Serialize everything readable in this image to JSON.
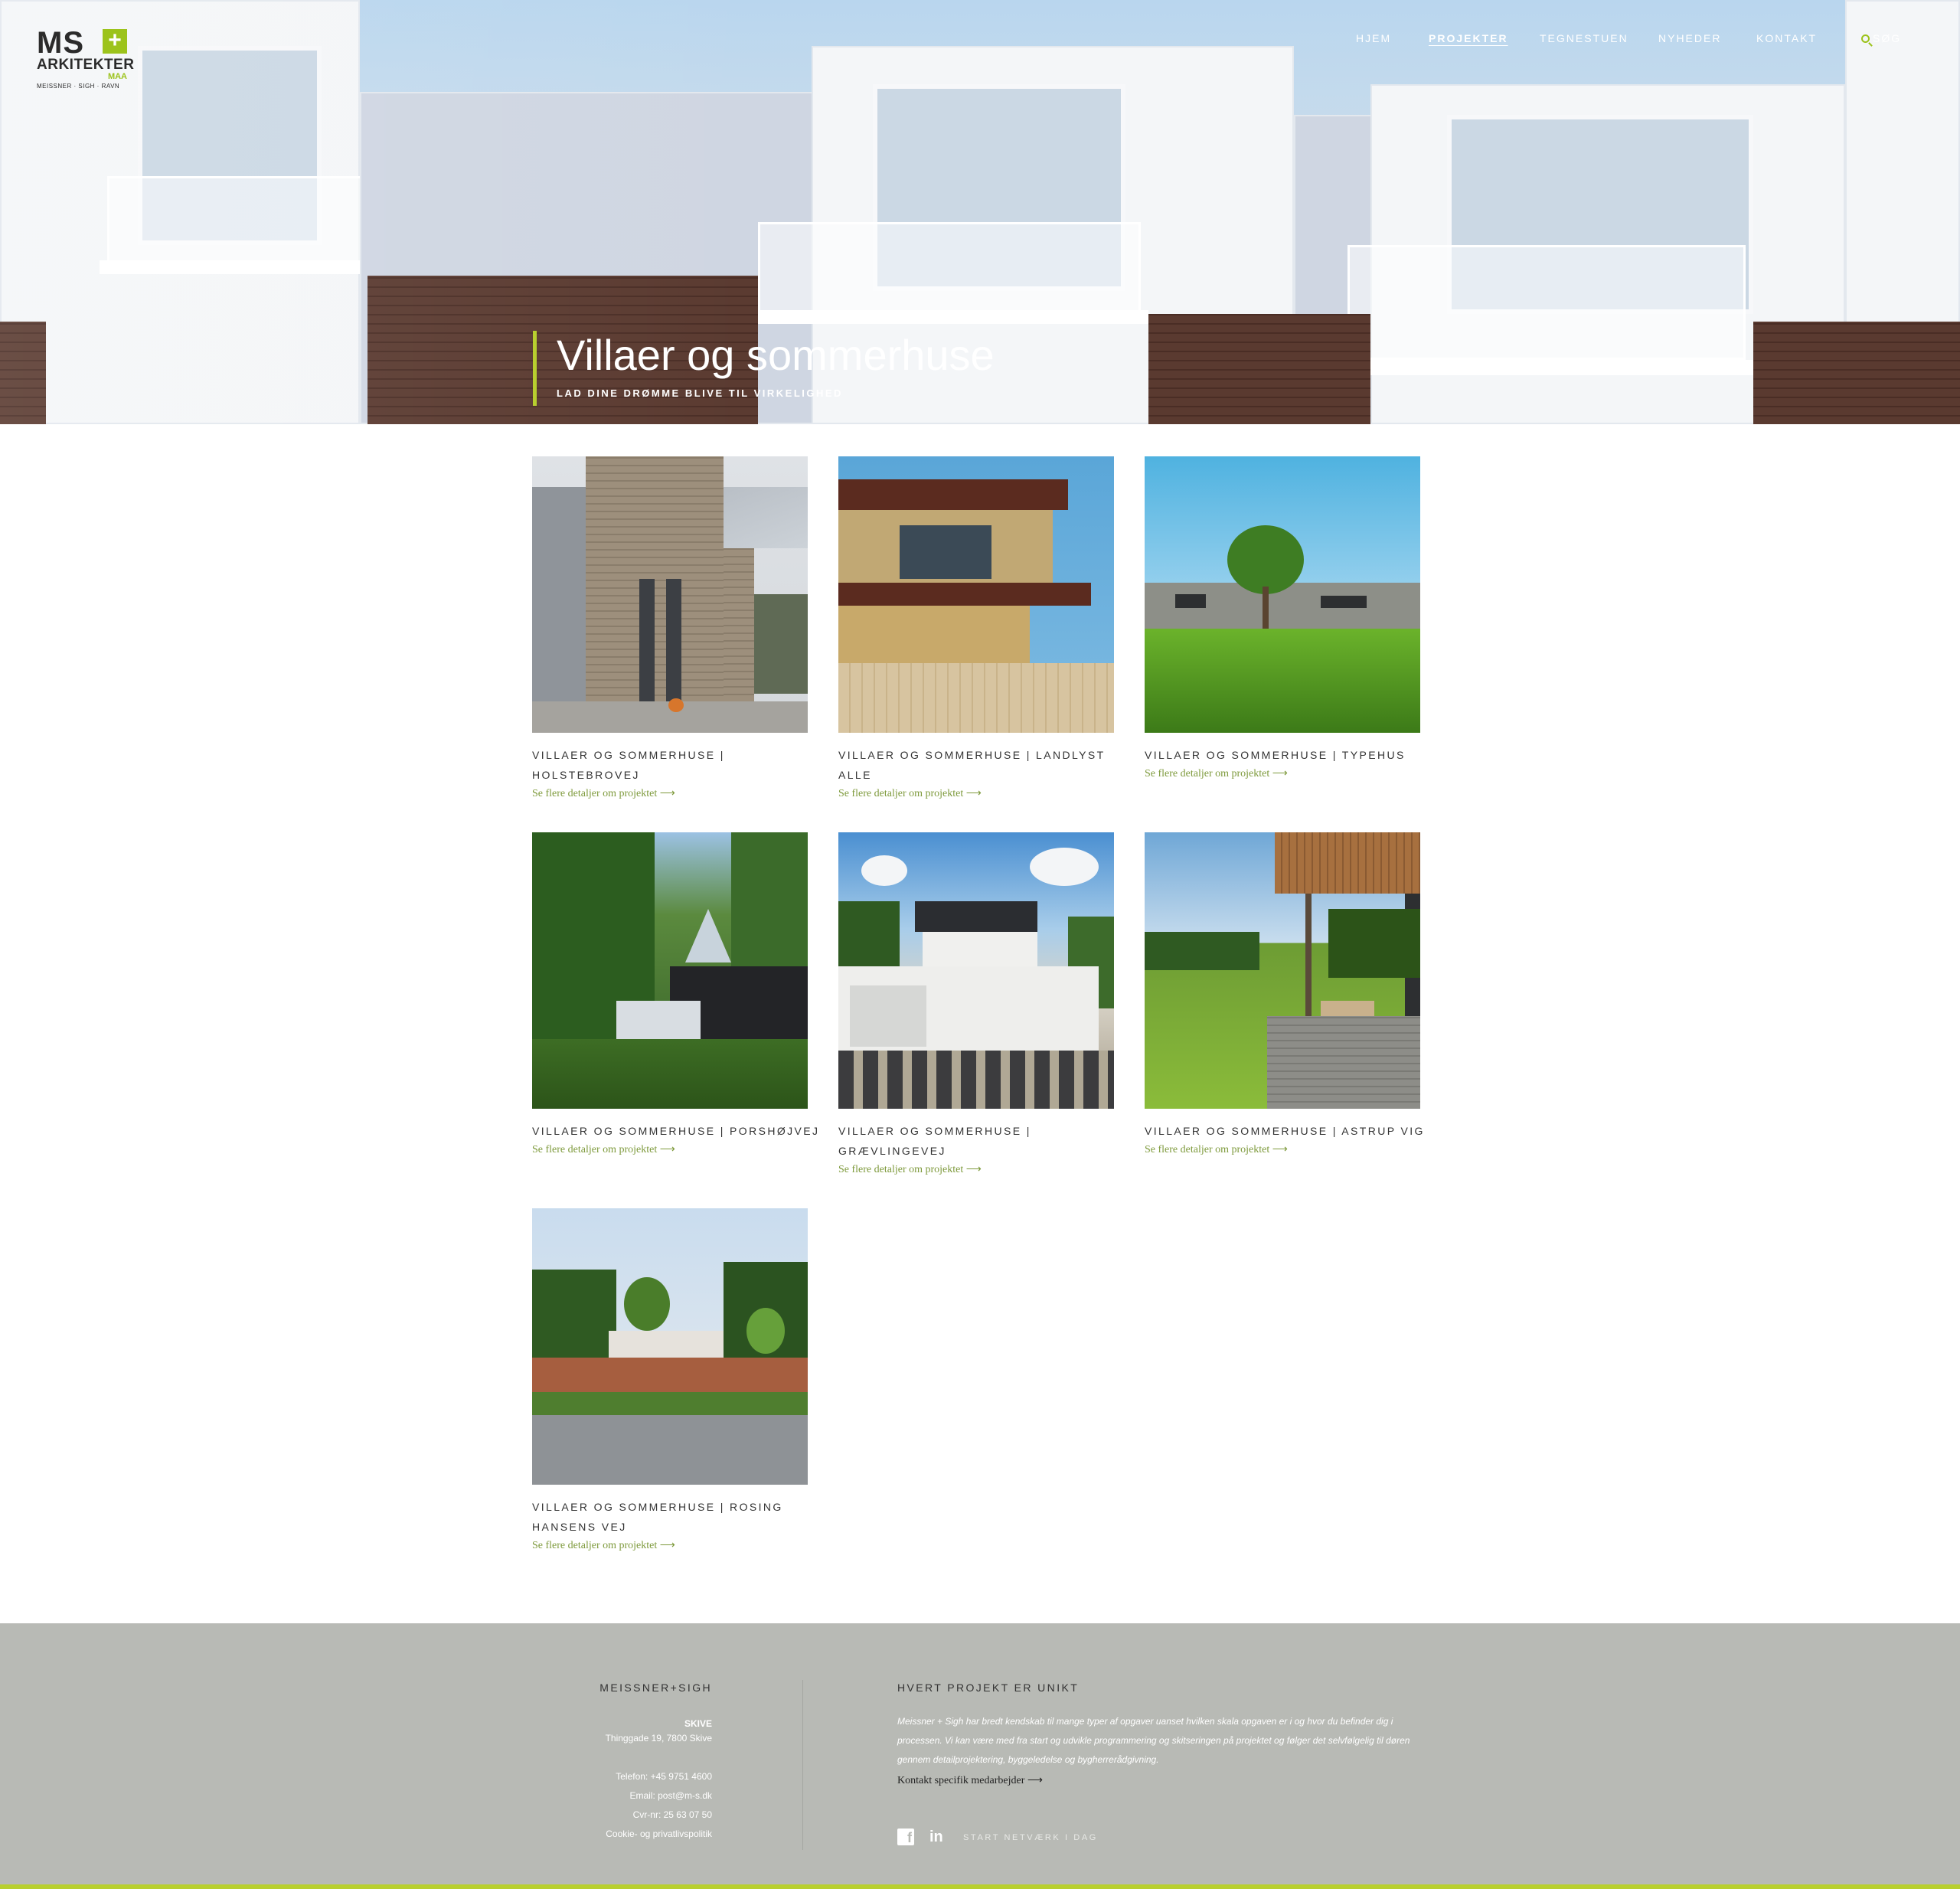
{
  "brand": {
    "logo_main": "MS",
    "logo_plus": "+",
    "logo_arkitekter": "ARKITEKTER",
    "logo_maa": "MAA",
    "logo_sub": "MEISSNER · SIGH · RAVN"
  },
  "nav": {
    "items": [
      {
        "label": "HJEM"
      },
      {
        "label": "PROJEKTER"
      },
      {
        "label": "TEGNESTUEN"
      },
      {
        "label": "NYHEDER"
      },
      {
        "label": "KONTAKT"
      }
    ],
    "search_label": "SØG",
    "active_item": "PROJEKTER"
  },
  "hero": {
    "title": "Villaer og sommerhuse",
    "subtitle": "LAD DINE DRØMME BLIVE TIL VIRKELIGHED"
  },
  "projects": [
    {
      "title": "VILLAER OG SOMMERHUSE   |   HOLSTEBROVEJ",
      "link": "Se flere detaljer om projektet ⟶"
    },
    {
      "title": "VILLAER OG SOMMERHUSE   |   LANDLYST ALLE",
      "link": "Se flere detaljer om projektet ⟶"
    },
    {
      "title": "VILLAER OG SOMMERHUSE   |   TYPEHUS",
      "link": "Se flere detaljer om projektet ⟶"
    },
    {
      "title": "VILLAER OG SOMMERHUSE   |   PORSHØJVEJ",
      "link": "Se flere detaljer om projektet ⟶"
    },
    {
      "title": "VILLAER OG SOMMERHUSE   |   GRÆVLINGEVEJ",
      "link": "Se flere detaljer om projektet ⟶"
    },
    {
      "title": "VILLAER OG SOMMERHUSE   |   ASTRUP VIG",
      "link": "Se flere detaljer om projektet ⟶"
    },
    {
      "title": "VILLAER OG SOMMERHUSE   |   ROSING HANSENS VEJ",
      "link": "Se flere detaljer om projektet ⟶"
    }
  ],
  "footer": {
    "org": "MEISSNER+SIGH",
    "city": "SKIVE",
    "address": "Thinggade 19, 7800 Skive",
    "phone": "Telefon: +45 9751 4600",
    "email": "Email: post@m-s.dk",
    "cvr": "Cvr-nr: 25 63 07 50",
    "policy": "Cookie- og privatlivspolitik",
    "heading": "HVERT PROJEKT ER UNIKT",
    "body": "Meissner + Sigh har bredt kendskab til mange typer af opgaver uanset hvilken skala opgaven er i og hvor du befinder dig i processen. Vi kan være med fra start og udvikle programmering og skitseringen på projektet og følger det selvfølgelig til døren gennem detailprojektering, byggeledelse og bygherrerådgivning.",
    "contact_link": "Kontakt specifik medarbejder ⟶",
    "social_text": "START NETVÆRK I DAG"
  },
  "colors": {
    "accent": "#9cc31b",
    "link": "#7e9a3c",
    "footer_bg": "#b8bab5"
  }
}
